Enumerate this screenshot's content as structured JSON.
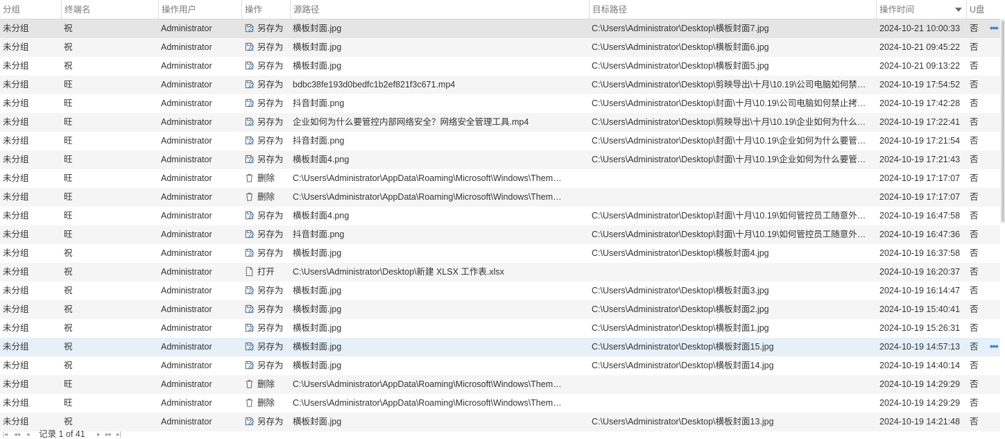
{
  "columns": {
    "group": "分组",
    "terminal": "终端名",
    "user": "操作用户",
    "op": "操作",
    "src": "源路径",
    "dst": "目标路径",
    "time": "操作时间",
    "usb": "U盘"
  },
  "rows": [
    {
      "group": "未分组",
      "terminal": "祝",
      "user": "Administrator",
      "op_icon": "save-as-icon",
      "op": "另存为",
      "src": "横板封面.jpg",
      "dst": "C:\\Users\\Administrator\\Desktop\\横板封面7.jpg",
      "time": "2024-10-21 10:00:33",
      "usb": "否"
    },
    {
      "group": "未分组",
      "terminal": "祝",
      "user": "Administrator",
      "op_icon": "save-as-icon",
      "op": "另存为",
      "src": "横板封面.jpg",
      "dst": "C:\\Users\\Administrator\\Desktop\\横板封面6.jpg",
      "time": "2024-10-21 09:45:22",
      "usb": "否"
    },
    {
      "group": "未分组",
      "terminal": "祝",
      "user": "Administrator",
      "op_icon": "save-as-icon",
      "op": "另存为",
      "src": "横板封面.jpg",
      "dst": "C:\\Users\\Administrator\\Desktop\\横板封面5.jpg",
      "time": "2024-10-21 09:13:22",
      "usb": "否"
    },
    {
      "group": "未分组",
      "terminal": "旺",
      "user": "Administrator",
      "op_icon": "save-as-icon",
      "op": "另存为",
      "src": "bdbc38fe193d0bedfc1b2ef821f3c671.mp4",
      "dst": "C:\\Users\\Administrator\\Desktop\\剪映导出\\十月\\10.19\\公司电脑如何禁…",
      "time": "2024-10-19 17:54:52",
      "usb": "否"
    },
    {
      "group": "未分组",
      "terminal": "旺",
      "user": "Administrator",
      "op_icon": "save-as-icon",
      "op": "另存为",
      "src": "抖音封面.png",
      "dst": "C:\\Users\\Administrator\\Desktop\\封面\\十月\\10.19\\公司电脑如何禁止拷…",
      "time": "2024-10-19 17:42:28",
      "usb": "否"
    },
    {
      "group": "未分组",
      "terminal": "旺",
      "user": "Administrator",
      "op_icon": "save-as-icon",
      "op": "另存为",
      "src": "企业如何为什么要管控内部网络安全？网络安全管理工具.mp4",
      "dst": "C:\\Users\\Administrator\\Desktop\\剪映导出\\十月\\10.19\\企业如何为什么…",
      "time": "2024-10-19 17:22:41",
      "usb": "否"
    },
    {
      "group": "未分组",
      "terminal": "旺",
      "user": "Administrator",
      "op_icon": "save-as-icon",
      "op": "另存为",
      "src": "抖音封面.png",
      "dst": "C:\\Users\\Administrator\\Desktop\\封面\\十月\\10.19\\企业如何为什么要管…",
      "time": "2024-10-19 17:21:54",
      "usb": "否"
    },
    {
      "group": "未分组",
      "terminal": "旺",
      "user": "Administrator",
      "op_icon": "save-as-icon",
      "op": "另存为",
      "src": "横板封面4.png",
      "dst": "C:\\Users\\Administrator\\Desktop\\封面\\十月\\10.19\\企业如何为什么要管…",
      "time": "2024-10-19 17:21:43",
      "usb": "否"
    },
    {
      "group": "未分组",
      "terminal": "旺",
      "user": "Administrator",
      "op_icon": "trash-icon",
      "op": "删除",
      "src": "C:\\Users\\Administrator\\AppData\\Roaming\\Microsoft\\Windows\\Them…",
      "dst": "",
      "time": "2024-10-19 17:17:07",
      "usb": "否"
    },
    {
      "group": "未分组",
      "terminal": "旺",
      "user": "Administrator",
      "op_icon": "trash-icon",
      "op": "删除",
      "src": "C:\\Users\\Administrator\\AppData\\Roaming\\Microsoft\\Windows\\Them…",
      "dst": "",
      "time": "2024-10-19 17:17:07",
      "usb": "否"
    },
    {
      "group": "未分组",
      "terminal": "旺",
      "user": "Administrator",
      "op_icon": "save-as-icon",
      "op": "另存为",
      "src": "横板封面4.png",
      "dst": "C:\\Users\\Administrator\\Desktop\\封面\\十月\\10.19\\如何管控员工随意外…",
      "time": "2024-10-19 16:47:58",
      "usb": "否"
    },
    {
      "group": "未分组",
      "terminal": "旺",
      "user": "Administrator",
      "op_icon": "save-as-icon",
      "op": "另存为",
      "src": "抖音封面.png",
      "dst": "C:\\Users\\Administrator\\Desktop\\封面\\十月\\10.19\\如何管控员工随意外…",
      "time": "2024-10-19 16:47:36",
      "usb": "否"
    },
    {
      "group": "未分组",
      "terminal": "祝",
      "user": "Administrator",
      "op_icon": "save-as-icon",
      "op": "另存为",
      "src": "横板封面.jpg",
      "dst": "C:\\Users\\Administrator\\Desktop\\横板封面4.jpg",
      "time": "2024-10-19 16:37:58",
      "usb": "否"
    },
    {
      "group": "未分组",
      "terminal": "祝",
      "user": "Administrator",
      "op_icon": "open-file-icon",
      "op": "打开",
      "src": "C:\\Users\\Administrator\\Desktop\\新建 XLSX 工作表.xlsx",
      "dst": "",
      "time": "2024-10-19 16:20:37",
      "usb": "否"
    },
    {
      "group": "未分组",
      "terminal": "祝",
      "user": "Administrator",
      "op_icon": "save-as-icon",
      "op": "另存为",
      "src": "横板封面.jpg",
      "dst": "C:\\Users\\Administrator\\Desktop\\横板封面3.jpg",
      "time": "2024-10-19 16:14:47",
      "usb": "否"
    },
    {
      "group": "未分组",
      "terminal": "祝",
      "user": "Administrator",
      "op_icon": "save-as-icon",
      "op": "另存为",
      "src": "横板封面.jpg",
      "dst": "C:\\Users\\Administrator\\Desktop\\横板封面2.jpg",
      "time": "2024-10-19 15:40:41",
      "usb": "否"
    },
    {
      "group": "未分组",
      "terminal": "祝",
      "user": "Administrator",
      "op_icon": "save-as-icon",
      "op": "另存为",
      "src": "横板封面.jpg",
      "dst": "C:\\Users\\Administrator\\Desktop\\横板封面1.jpg",
      "time": "2024-10-19 15:26:31",
      "usb": "否"
    },
    {
      "group": "未分组",
      "terminal": "祝",
      "user": "Administrator",
      "op_icon": "save-as-icon",
      "op": "另存为",
      "src": "横板封面.jpg",
      "dst": "C:\\Users\\Administrator\\Desktop\\横板封面15.jpg",
      "time": "2024-10-19 14:57:13",
      "usb": "否"
    },
    {
      "group": "未分组",
      "terminal": "祝",
      "user": "Administrator",
      "op_icon": "save-as-icon",
      "op": "另存为",
      "src": "横板封面.jpg",
      "dst": "C:\\Users\\Administrator\\Desktop\\横板封面14.jpg",
      "time": "2024-10-19 14:40:14",
      "usb": "否"
    },
    {
      "group": "未分组",
      "terminal": "旺",
      "user": "Administrator",
      "op_icon": "trash-icon",
      "op": "删除",
      "src": "C:\\Users\\Administrator\\AppData\\Roaming\\Microsoft\\Windows\\Them…",
      "dst": "",
      "time": "2024-10-19 14:29:29",
      "usb": "否"
    },
    {
      "group": "未分组",
      "terminal": "旺",
      "user": "Administrator",
      "op_icon": "trash-icon",
      "op": "删除",
      "src": "C:\\Users\\Administrator\\AppData\\Roaming\\Microsoft\\Windows\\Them…",
      "dst": "",
      "time": "2024-10-19 14:29:29",
      "usb": "否"
    },
    {
      "group": "未分组",
      "terminal": "祝",
      "user": "Administrator",
      "op_icon": "save-as-icon",
      "op": "另存为",
      "src": "横板封面.jpg",
      "dst": "C:\\Users\\Administrator\\Desktop\\横板封面13.jpg",
      "time": "2024-10-19 14:21:48",
      "usb": "否"
    }
  ],
  "selected_row": 0,
  "hovered_row": 17,
  "more_button_label": "•••",
  "pager": {
    "text": "记录 1 of 41"
  },
  "colors": {
    "accent": "#2f7fd1",
    "selected_row": "#e5e5e5",
    "hover_row": "#e6f0f8"
  }
}
